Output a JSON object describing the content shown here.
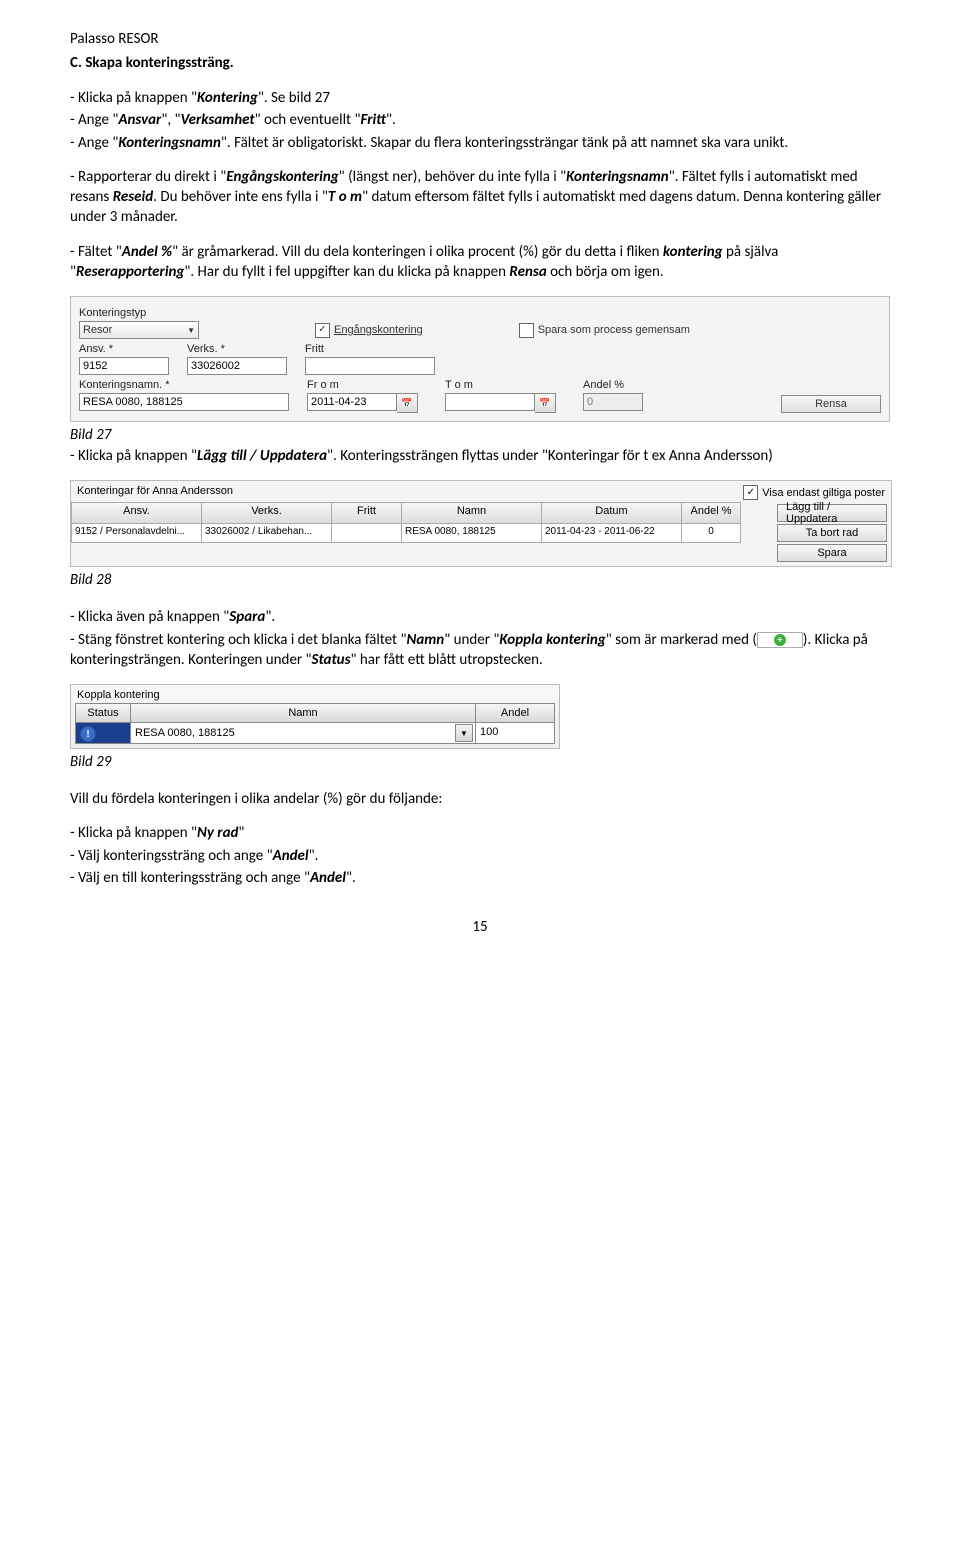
{
  "doc": {
    "header": "Palasso RESOR",
    "section": "C. Skapa konteringssträng.",
    "para1_a": "- Klicka på knappen \"",
    "para1_b": "Kontering",
    "para1_c": "\". Se bild 27",
    "para2_a": "- Ange \"",
    "para2_b": "Ansvar",
    "para2_c": "\", \"",
    "para2_d": "Verksamhet",
    "para2_e": "\" och eventuellt \"",
    "para2_f": "Fritt",
    "para2_g": "\".",
    "para3_a": "- Ange \"",
    "para3_b": "Konteringsnamn",
    "para3_c": "\". Fältet är obligatoriskt. Skapar du flera konteringssträngar tänk på att namnet ska vara unikt.",
    "para4_a": "- Rapporterar du direkt i \"",
    "para4_b": "Engångskontering",
    "para4_c": "\" (längst ner), behöver du inte fylla i \"",
    "para4_d": "Konteringsnamn",
    "para4_e": "\". Fältet fylls i automatiskt med resans ",
    "para4_f": "Reseid",
    "para4_g": ". Du behöver inte ens fylla i \"",
    "para4_h": "T o m",
    "para4_i": "\" datum eftersom fältet fylls i automatiskt med dagens datum. Denna kontering gäller under 3 månader.",
    "para5_a": "- Fältet \"",
    "para5_b": "Andel %",
    "para5_c": "\" är gråmarkerad. Vill du dela konteringen i olika procent (%) gör du detta i fliken ",
    "para5_d": "kontering",
    "para5_e": " på själva \"",
    "para5_f": "Reserapportering",
    "para5_g": "\". Har du fyllt i fel uppgifter kan du klicka på knappen ",
    "para5_h": "Rensa",
    "para5_i": " och börja om igen.",
    "bild27": "Bild 27",
    "para6_a": "- Klicka på knappen \"",
    "para6_b": "Lägg till / Uppdatera",
    "para6_c": "\". Konteringssträngen flyttas under \"Konteringar för t ex Anna Andersson)",
    "bild28": "Bild 28",
    "para7_a": "- Klicka även på knappen \"",
    "para7_b": "Spara",
    "para7_c": "\".",
    "para8_a": "- Stäng fönstret kontering och klicka i det blanka fältet \"",
    "para8_b": "Namn",
    "para8_c": "\" under \"",
    "para8_d": "Koppla kontering",
    "para8_e": "\" som är markerad med (",
    "para8_f": "). Klicka på konteringsträngen. Konteringen under \"",
    "para8_g": "Status",
    "para8_h": "\" har fått ett blått utropstecken.",
    "bild29": "Bild 29",
    "para9": "Vill du fördela konteringen i olika andelar (%) gör du följande:",
    "para10_a": "- Klicka på knappen \"",
    "para10_b": "Ny rad",
    "para10_c": "\"",
    "para11_a": "- Välj konteringssträng och ange \"",
    "para11_b": "Andel",
    "para11_c": "\".",
    "para12_a": "- Välj en till konteringssträng och ange \"",
    "para12_b": "Andel",
    "para12_c": "\".",
    "page": "15"
  },
  "panel1": {
    "l_konttyp": "Konteringstyp",
    "v_konttyp": "Resor",
    "cb_engang": "Engångskontering",
    "cb_spara": "Spara som process gemensam",
    "l_ansv": "Ansv. *",
    "v_ansv": "9152",
    "l_verks": "Verks. *",
    "v_verks": "33026002",
    "l_fritt": "Fritt",
    "v_fritt": "",
    "l_knamn": "Konteringsnamn. *",
    "v_knamn": "RESA 0080, 188125",
    "l_from": "Fr o m",
    "v_from": "2011-04-23",
    "l_tom": "T o m",
    "v_tom": "",
    "l_andel": "Andel %",
    "v_andel": "0",
    "btn_rensa": "Rensa"
  },
  "panel2": {
    "title": "Konteringar för Anna Andersson",
    "cb_visa": "Visa endast giltiga poster",
    "h_ansv": "Ansv.",
    "h_verks": "Verks.",
    "h_fritt": "Fritt",
    "h_namn": "Namn",
    "h_datum": "Datum",
    "h_andel": "Andel %",
    "r_ansv": "9152 / Personalavdelni...",
    "r_verks": "33026002 / Likabehan...",
    "r_fritt": "",
    "r_namn": "RESA 0080, 188125",
    "r_datum": "2011-04-23 - 2011-06-22",
    "r_andel": "0",
    "btn_lagg": "Lägg till / Uppdatera",
    "btn_tabort": "Ta bort rad",
    "btn_spara": "Spara"
  },
  "panel3": {
    "title": "Koppla kontering",
    "h_status": "Status",
    "h_namn": "Namn",
    "h_andel": "Andel",
    "sel_val": "RESA 0080, 188125",
    "andel_val": "100"
  }
}
